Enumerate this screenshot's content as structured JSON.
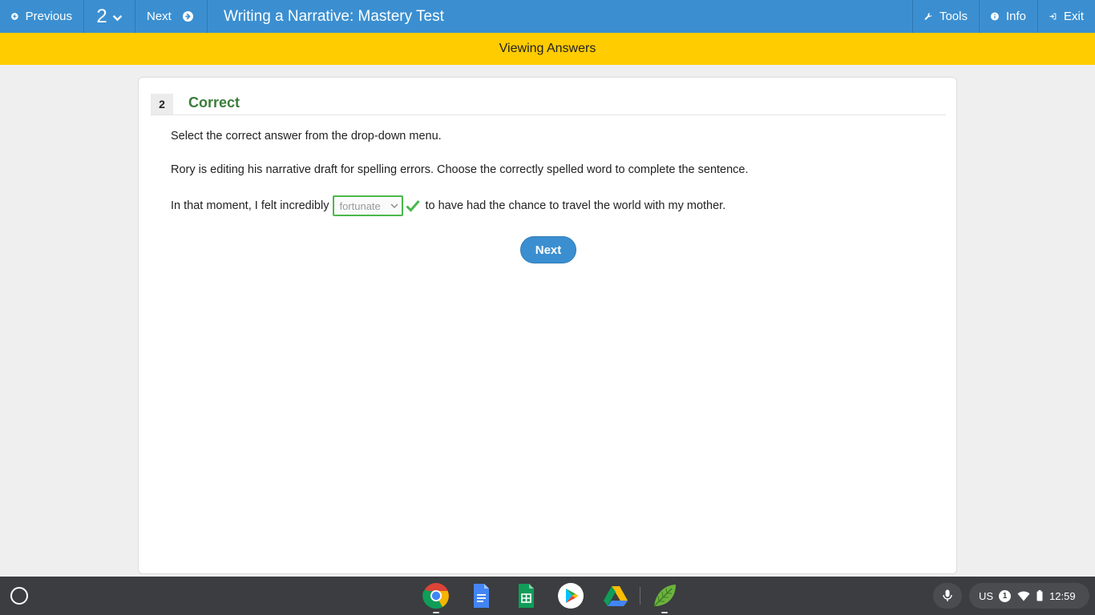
{
  "topbar": {
    "previous_label": "Previous",
    "question_number": "2",
    "next_label": "Next",
    "title": "Writing a Narrative: Mastery Test",
    "tools_label": "Tools",
    "info_label": "Info",
    "exit_label": "Exit"
  },
  "banner": {
    "text": "Viewing Answers"
  },
  "question": {
    "number": "2",
    "status": "Correct",
    "instruction": "Select the correct answer from the drop-down menu.",
    "prompt": "Rory is editing his narrative draft for spelling errors. Choose the correctly spelled word to complete the sentence.",
    "sentence_before": "In that moment, I felt incredibly",
    "selected_answer": "fortunate",
    "sentence_after": "to have had the chance to travel the world with my mother.",
    "next_button": "Next"
  },
  "colors": {
    "topbar": "#3b8fd0",
    "banner": "#ffcc00",
    "correct": "#3a7d3a",
    "check": "#4bb84b"
  },
  "shelf": {
    "apps": [
      "chrome-icon",
      "docs-icon",
      "sheets-icon",
      "play-store-icon",
      "drive-icon",
      "leaf-app-icon"
    ],
    "tray": {
      "locale": "US",
      "notification_count": "1",
      "time": "12:59"
    }
  }
}
